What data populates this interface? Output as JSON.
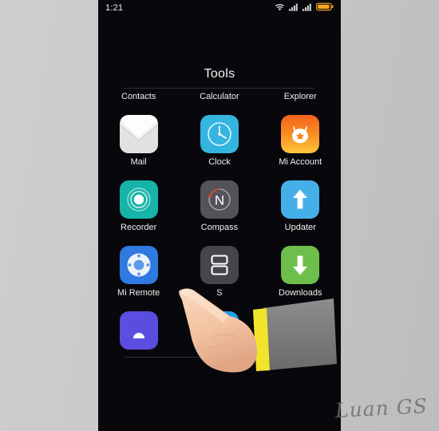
{
  "screen": {
    "background_color": "#08080c",
    "surround_color": "#c9c9c9"
  },
  "status_bar": {
    "time": "1:21",
    "icons": [
      {
        "name": "wifi-icon",
        "label": "wifi"
      },
      {
        "name": "signal-sim1-icon",
        "label": "signal"
      },
      {
        "name": "signal-sim2-icon",
        "label": "signal"
      },
      {
        "name": "battery-icon",
        "label": "battery",
        "color": "#f5a623"
      }
    ]
  },
  "folder": {
    "title": "Tools"
  },
  "apps": [
    {
      "label": "Contacts",
      "icon": "contacts-icon",
      "color": "#37a8e0"
    },
    {
      "label": "Calculator",
      "icon": "calculator-icon",
      "color": "#f47b2a"
    },
    {
      "label": "Explorer",
      "icon": "explorer-icon",
      "color": "#fbc24a"
    },
    {
      "label": "Mail",
      "icon": "mail-icon",
      "color": "#f2f2f2"
    },
    {
      "label": "Clock",
      "icon": "clock-icon",
      "color": "#33b5e0"
    },
    {
      "label": "Mi Account",
      "icon": "mi-account-icon",
      "color": "#f7781d"
    },
    {
      "label": "Recorder",
      "icon": "recorder-icon",
      "color": "#16b3a8"
    },
    {
      "label": "Compass",
      "icon": "compass-icon",
      "color": "#53535a"
    },
    {
      "label": "Updater",
      "icon": "updater-icon",
      "color": "#45b0e8"
    },
    {
      "label": "Mi Remote",
      "icon": "mi-remote-icon",
      "color": "#2f79e0"
    },
    {
      "label": "S",
      "icon": "screenshot-icon",
      "color": "#46464a"
    },
    {
      "label": "Downloads",
      "icon": "downloads-icon",
      "color": "#6ebe4c"
    },
    {
      "label": "",
      "icon": "notes-icon",
      "color": "#5b4de0"
    },
    {
      "label": "",
      "icon": "weather-icon",
      "color": "#1e9de8"
    },
    {
      "label": "",
      "icon": "themes-icon",
      "color": "#f2562a"
    }
  ],
  "watermark": {
    "text": "Luan GS"
  }
}
